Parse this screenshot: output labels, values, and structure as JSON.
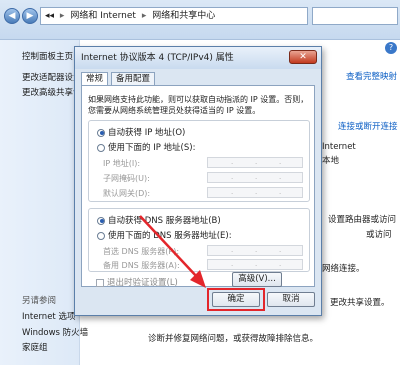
{
  "window": {
    "address": [
      "网络和 Internet",
      "网络和共享中心"
    ],
    "help": "?"
  },
  "left_pane": {
    "items": [
      "控制面板主页",
      "更改适配器设置",
      "更改高级共享设"
    ],
    "see_also_title": "另请参阅",
    "see_also": [
      "Internet 选项",
      "Windows 防火墙",
      "家庭组"
    ]
  },
  "right_pane": {
    "view_full_map": "查看完整映射",
    "connect_disconnect": "连接或断开连接",
    "internet_label": "Internet",
    "internet_sub": "本地",
    "router_text": "设置路由器或访问",
    "connect_text": "或访问",
    "network_conn": "网络连接。",
    "share_text": "更改共享设置。",
    "troubleshoot": "诊断并修复网络问题，或获得故障排除信息。"
  },
  "dialog": {
    "title": "Internet 协议版本 4 (TCP/IPv4) 属性",
    "close": "✕",
    "tabs": [
      "常规",
      "备用配置"
    ],
    "description": "如果网络支持此功能，则可以获取自动指派的 IP 设置。否则，您需要从网络系统管理员处获得适当的 IP 设置。",
    "ip_auto": "自动获得 IP 地址(O)",
    "ip_manual": "使用下面的 IP 地址(S):",
    "ip_fields": [
      "IP 地址(I):",
      "子网掩码(U):",
      "默认网关(D):"
    ],
    "dns_auto": "自动获得 DNS 服务器地址(B)",
    "dns_manual": "使用下面的 DNS 服务器地址(E):",
    "dns_fields": [
      "首选 DNS 服务器(P):",
      "备用 DNS 服务器(A):"
    ],
    "validate": "退出时验证设置(L)",
    "advanced": "高级(V)...",
    "ok": "确定",
    "cancel": "取消"
  }
}
